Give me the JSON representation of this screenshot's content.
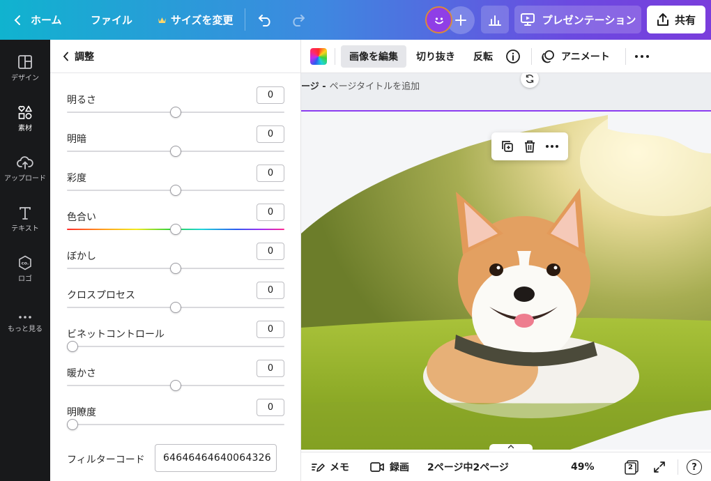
{
  "topbar": {
    "home_label": "ホーム",
    "file_label": "ファイル",
    "resize_label": "サイズを変更",
    "present_label": "プレゼンテーション",
    "share_label": "共有"
  },
  "rail": {
    "items": [
      {
        "label": "デザイン",
        "icon": "layout-icon"
      },
      {
        "label": "素材",
        "icon": "elements-icon"
      },
      {
        "label": "アップロード",
        "icon": "upload-cloud-icon"
      },
      {
        "label": "テキスト",
        "icon": "text-icon"
      },
      {
        "label": "ロゴ",
        "icon": "logo-icon"
      },
      {
        "label": "もっと見る",
        "icon": "more-dots-icon"
      }
    ]
  },
  "panel": {
    "title": "調整",
    "adjustments": [
      {
        "label": "明るさ",
        "value": "0",
        "level": 0.5
      },
      {
        "label": "明暗",
        "value": "0",
        "level": 0.5
      },
      {
        "label": "彩度",
        "value": "0",
        "level": 0.5
      },
      {
        "label": "色合い",
        "value": "0",
        "level": 0.5
      },
      {
        "label": "ぼかし",
        "value": "0",
        "level": 0.5
      },
      {
        "label": "クロスプロセス",
        "value": "0",
        "level": 0.5
      },
      {
        "label": "ビネットコントロール",
        "value": "0",
        "level": 0.0
      },
      {
        "label": "暖かさ",
        "value": "0",
        "level": 0.5
      },
      {
        "label": "明瞭度",
        "value": "0",
        "level": 0.0
      }
    ],
    "filter_label": "フィルターコード",
    "filter_code": "64646464640064326"
  },
  "toolbar": {
    "edit_image": "画像を編集",
    "crop": "切り抜き",
    "flip": "反転",
    "animate": "アニメート"
  },
  "canvas": {
    "page_prefix": "ージ -",
    "page_title_placeholder": "ページタイトルを追加"
  },
  "bottombar": {
    "notes": "メモ",
    "record": "録画",
    "page_counter": "2ページ中2ページ",
    "zoom": "49%",
    "page_count_badge": "2",
    "help": "?"
  },
  "colors": {
    "accent_purple": "#8b3cf0",
    "rail_bg": "#18191b"
  }
}
